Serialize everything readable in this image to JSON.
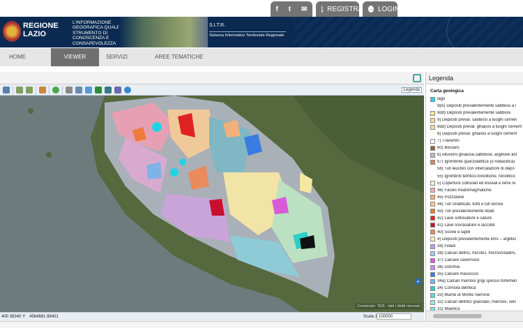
{
  "top": {
    "social": [
      "f",
      "t",
      "✉"
    ],
    "register_label": "REGISTRATI",
    "login_label": "LOGIN"
  },
  "header": {
    "brand_line1": "REGIONE",
    "brand_line2": "LAZIO",
    "tagline": "L'INFORMAZIONE GEOGRAFICA QUALE STRUMENTO DI CONOSCENZA E CONSAPEVOLEZZA",
    "sitr": "S.I.T.R.",
    "sitr_sub": "Sistema Informativo Territoriale Regionale"
  },
  "nav": {
    "items": [
      "HOME",
      "VIEWER",
      "SERVIZI",
      "AREE TEMATICHE"
    ],
    "active": "VIEWER"
  },
  "map": {
    "toolbar_legend": "Legenda",
    "attribution": "Contenuto: TER - fatti i diritti riservati",
    "coords": "400 38340",
    "y_label": "Y:",
    "y_value": "4564881.98401",
    "scale_label": "Scala 1:",
    "scale_value": "100000"
  },
  "legend": {
    "title": "Legenda",
    "subtitle": "Carta geologica",
    "items": [
      {
        "label": "lago",
        "color": "#22d3e3"
      },
      {
        "label": "9ps) Depositi prevalentemente sabbiosi a l",
        "color": null
      },
      {
        "label": "9dd) Depositi prevalentemente sabbiosi",
        "color": "#f6e7a0"
      },
      {
        "label": "9) Depositi preval. sabbiosi a luoghi cemen",
        "color": "#f2dba0"
      },
      {
        "label": "8dd) Depositi preval. ghiaiosi a luoghi cement",
        "color": "#f5d9a6"
      },
      {
        "label": "8) Depositi preval. ghiaiosi a luoghi cement",
        "color": null
      },
      {
        "label": "7) Travertini",
        "color": "#ffffff"
      },
      {
        "label": "60) Bisciaro",
        "color": "#8a6a4a"
      },
      {
        "label": "6) Alluvioni ghiaiose,sabbiose, argillose ant",
        "color": "#bdbdbd"
      },
      {
        "label": "57) Ignimbrite quarzolatitica (o riodacitica)",
        "color": "#d6896a"
      },
      {
        "label": "56) Tufi leucitici con intercalazioni di depo",
        "color": null
      },
      {
        "label": "55) Ignimbriti tefritico-fonolitiche, fonolitico",
        "color": null
      },
      {
        "label": "5) Coperture colluviali ed eluviali e terre re",
        "color": "#f0f4d4"
      },
      {
        "label": "46) Facies freatomagmatiche",
        "color": "#f1aab8"
      },
      {
        "label": "45) Pozzolane",
        "color": "#f2b07a"
      },
      {
        "label": "44) Tufi stratificati, tufiti e tufi terrosi",
        "color": "#f7c89a"
      },
      {
        "label": "43) Tufi prevalentemente litoidi",
        "color": "#f07a3a"
      },
      {
        "label": "42) Lave sottosature e sature",
        "color": "#e02222"
      },
      {
        "label": "41) Lave sovrasature e laccoliti",
        "color": "#c8102e"
      },
      {
        "label": "40) Scorie e lapilli",
        "color": "#e98b5a"
      },
      {
        "label": "4) Depositi prevalentemente limo – argillos",
        "color": "#f7f2c8"
      },
      {
        "label": "39) Filladi",
        "color": "#b9a0e6"
      },
      {
        "label": "38) Calcari detrici, micritici, microcristallini,",
        "color": "#a8c8f0"
      },
      {
        "label": "37) Calcare cavernoso",
        "color": "#d85ad8"
      },
      {
        "label": "36) Dolomia",
        "color": "#c78ef2"
      },
      {
        "label": "35) Calcare massiccio",
        "color": "#3a7be0"
      },
      {
        "label": "34a) Calcari marnosi grigi spesso fortemen",
        "color": "#7fb3e8"
      },
      {
        "label": "34) Corniola detritica",
        "color": "#2ccfc7"
      },
      {
        "label": "33) Marne di Monte Serrone",
        "color": "#5ee0d0"
      },
      {
        "label": "32) Calcari detritici granulari, marnosi, selc",
        "color": "#a6e8d8"
      },
      {
        "label": "31) Maiolica",
        "color": "#7ee0e8"
      }
    ]
  }
}
